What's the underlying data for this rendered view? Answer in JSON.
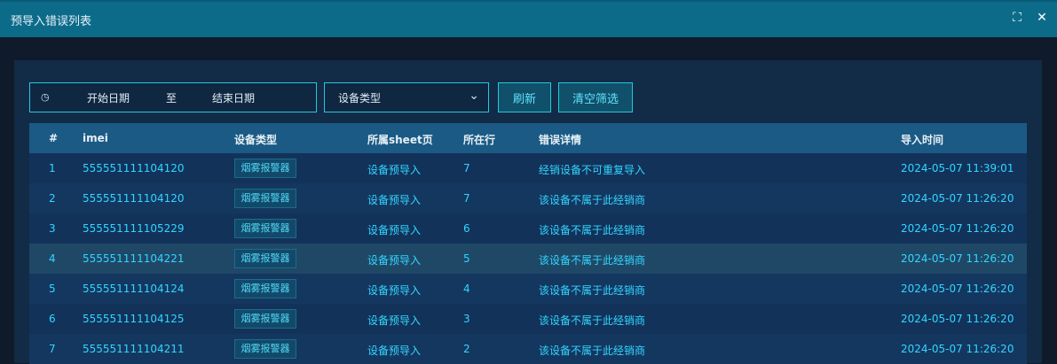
{
  "window": {
    "title": "预导入错误列表",
    "icons": [
      "fullscreen-icon",
      "close-icon"
    ]
  },
  "filters": {
    "date_range": {
      "start_placeholder": "开始日期",
      "separator": "至",
      "end_placeholder": "结束日期",
      "icon": "clock-icon"
    },
    "device_type_select": {
      "placeholder": "设备类型",
      "icon": "chevron-down-icon"
    },
    "buttons": {
      "refresh": "刷新",
      "clear": "清空筛选"
    }
  },
  "table": {
    "headers": [
      "#",
      "imei",
      "设备类型",
      "所属sheet页",
      "所在行",
      "错误详情",
      "导入时间"
    ],
    "rows": [
      {
        "num": "1",
        "imei": "555551111104120",
        "device_type": "烟雾报警器",
        "sheet": "设备预导入",
        "row": "7",
        "error": "经销设备不可重复导入",
        "time": "2024-05-07 11:39:01"
      },
      {
        "num": "2",
        "imei": "555551111104120",
        "device_type": "烟雾报警器",
        "sheet": "设备预导入",
        "row": "7",
        "error": "该设备不属于此经销商",
        "time": "2024-05-07 11:26:20"
      },
      {
        "num": "3",
        "imei": "555551111105229",
        "device_type": "烟雾报警器",
        "sheet": "设备预导入",
        "row": "6",
        "error": "该设备不属于此经销商",
        "time": "2024-05-07 11:26:20"
      },
      {
        "num": "4",
        "imei": "555551111104221",
        "device_type": "烟雾报警器",
        "sheet": "设备预导入",
        "row": "5",
        "error": "该设备不属于此经销商",
        "time": "2024-05-07 11:26:20"
      },
      {
        "num": "5",
        "imei": "555551111104124",
        "device_type": "烟雾报警器",
        "sheet": "设备预导入",
        "row": "4",
        "error": "该设备不属于此经销商",
        "time": "2024-05-07 11:26:20"
      },
      {
        "num": "6",
        "imei": "555551111104125",
        "device_type": "烟雾报警器",
        "sheet": "设备预导入",
        "row": "3",
        "error": "该设备不属于此经销商",
        "time": "2024-05-07 11:26:20"
      },
      {
        "num": "7",
        "imei": "555551111104211",
        "device_type": "烟雾报警器",
        "sheet": "设备预导入",
        "row": "2",
        "error": "该设备不属于此经销商",
        "time": "2024-05-07 11:26:20"
      }
    ]
  },
  "colors": {
    "titlebar": "#0d6b8a",
    "accent": "#22c9e0",
    "header_row": "#1b5a85",
    "text_cyan": "#32d6ff"
  }
}
